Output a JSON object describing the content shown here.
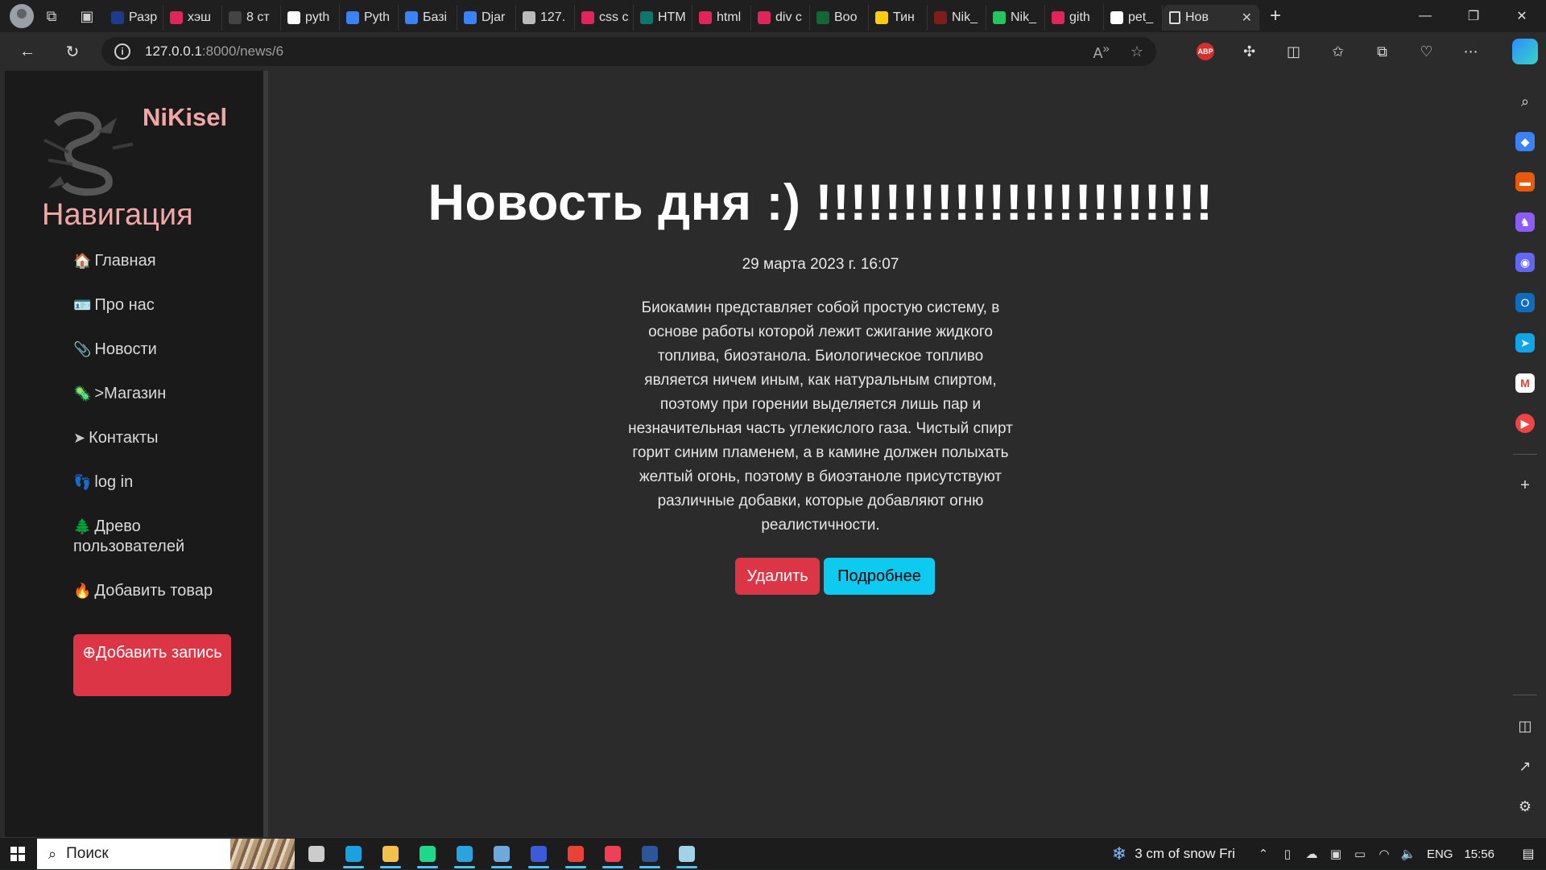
{
  "browser": {
    "tabs": [
      {
        "label": "Разр",
        "color": "#1e3a8a"
      },
      {
        "label": "хэш",
        "color": "#e0245e"
      },
      {
        "label": "8 ст",
        "color": "#444444"
      },
      {
        "label": "pyth",
        "color": "#ffffff"
      },
      {
        "label": "Pyth",
        "color": "#3b82f6"
      },
      {
        "label": "Базі",
        "color": "#3b82f6"
      },
      {
        "label": "Djar",
        "color": "#3b82f6"
      },
      {
        "label": "127.",
        "color": "#bbbbbb"
      },
      {
        "label": "css с",
        "color": "#e0245e"
      },
      {
        "label": "HTM",
        "color": "#0f766e"
      },
      {
        "label": "html",
        "color": "#e0245e"
      },
      {
        "label": "div с",
        "color": "#e0245e"
      },
      {
        "label": "Boo",
        "color": "#166534"
      },
      {
        "label": "Тин",
        "color": "#facc15"
      },
      {
        "label": "Nik_",
        "color": "#7f1d1d"
      },
      {
        "label": "Nik_",
        "color": "#22c55e"
      },
      {
        "label": "gith",
        "color": "#e0245e"
      },
      {
        "label": "pet_",
        "color": "#ffffff"
      },
      {
        "label": "Нов",
        "color": "#dddddd"
      }
    ],
    "active_tab": {
      "close": "✕"
    },
    "url_host": "127.0.0.1",
    "url_path": ":8000/news/6",
    "abp_label": "ABP"
  },
  "sidebar": {
    "brand": "NiKisel",
    "nav_title": "Навигация",
    "items": [
      {
        "icon": "🏠",
        "label": "Главная"
      },
      {
        "icon": "🪪",
        "label": "Про нас"
      },
      {
        "icon": "📎",
        "label": "Новости"
      },
      {
        "icon": "🦠",
        "label": ">Магазин"
      },
      {
        "icon": "➤",
        "label": "Контакты"
      },
      {
        "icon": "👣",
        "label": "log in"
      },
      {
        "icon": "🌲",
        "label": "Древо пользователей"
      },
      {
        "icon": "🔥",
        "label": "Добавить товар"
      }
    ],
    "add_button": "Добавить запись"
  },
  "news": {
    "title": "Новость дня :) !!!!!!!!!!!!!!!!!!!!!!!",
    "date": "29 марта 2023 г. 16:07",
    "body": "Биокамин представляет собой простую систему, в основе работы которой лежит сжигание жидкого топлива, биоэтанола. Биологическое топливо является ничем иным, как натуральным спиртом, поэтому при горении выделяется лишь пар и незначительная часть углекислого газа. Чистый спирт горит синим пламенем, а в камине должен полыхать желтый огонь, поэтому в биоэтаноле присутствуют различные добавки, которые добавляют огню реалистичности.",
    "delete_label": "Удалить",
    "more_label": "Подробнее"
  },
  "taskbar": {
    "search_placeholder": "Поиск",
    "weather": "3 cm of snow Fri",
    "lang": "ENG",
    "time": "15:56",
    "apps": [
      {
        "name": "task-view",
        "color": "#cccccc"
      },
      {
        "name": "edge",
        "color": "#1ba1e2"
      },
      {
        "name": "explorer",
        "color": "#f2c14e"
      },
      {
        "name": "pycharm",
        "color": "#21d789"
      },
      {
        "name": "telegram",
        "color": "#2aa3e0"
      },
      {
        "name": "app-blue",
        "color": "#6fa8dc"
      },
      {
        "name": "save",
        "color": "#3b5bdb"
      },
      {
        "name": "chrome",
        "color": "#ea4335"
      },
      {
        "name": "pocket",
        "color": "#ef4056"
      },
      {
        "name": "word",
        "color": "#2b579a"
      },
      {
        "name": "pencil-app",
        "color": "#9fd3e6"
      }
    ]
  }
}
